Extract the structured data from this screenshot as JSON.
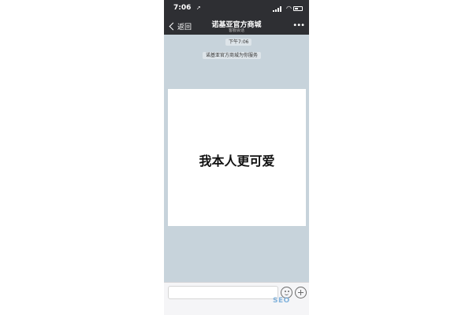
{
  "status_bar": {
    "time": "7:06",
    "location_glyph": "➚"
  },
  "header": {
    "back_label": "返回",
    "title": "诺基亚官方商城",
    "subtitle": "客服会话",
    "more_glyph": "•••"
  },
  "chat": {
    "time_label": "下午7:06",
    "system_message": "诺基亚官方商城为你服务",
    "image_card_text": "我本人更可爱"
  },
  "input_bar": {
    "placeholder": ""
  },
  "watermark": {
    "text": "SEO"
  },
  "colors": {
    "header_bg": "#2e2f33",
    "chat_bg": "#c7d3db",
    "bubble_bg": "#dde4e9"
  }
}
